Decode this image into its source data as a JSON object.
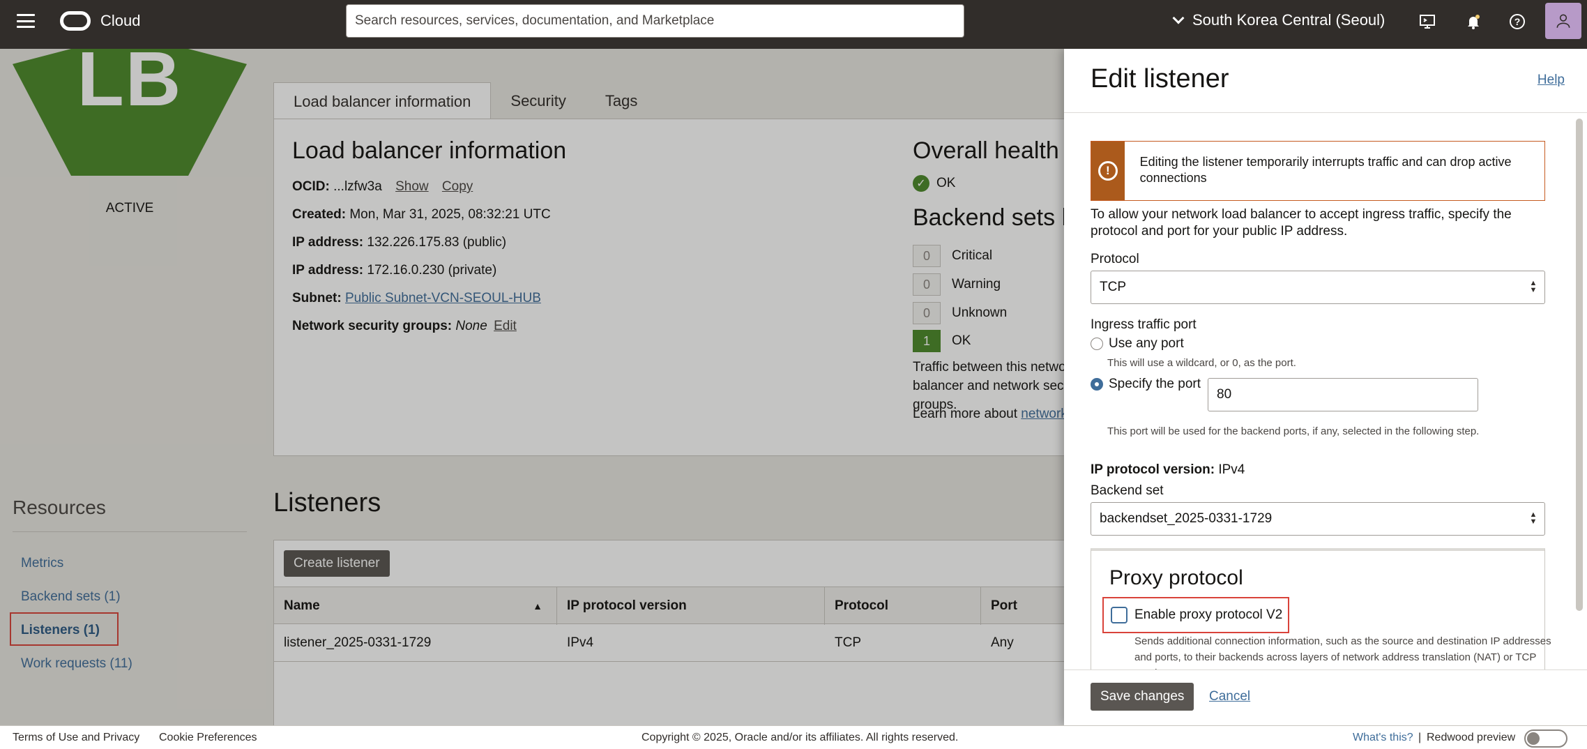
{
  "topbar": {
    "brand": "Cloud",
    "search_placeholder": "Search resources, services, documentation, and Marketplace",
    "region": "South Korea Central (Seoul)"
  },
  "lb": {
    "badge": "LB",
    "status": "ACTIVE",
    "tabs": [
      "Load balancer information",
      "Security",
      "Tags"
    ],
    "info_title": "Load balancer information",
    "ocid_label": "OCID:",
    "ocid_value": "...lzfw3a",
    "show": "Show",
    "copy": "Copy",
    "created_label": "Created:",
    "created_value": "Mon, Mar 31, 2025, 08:32:21 UTC",
    "ip_label": "IP address:",
    "ip_public": "132.226.175.83 (public)",
    "ip_private": "172.16.0.230 (private)",
    "subnet_label": "Subnet:",
    "subnet_value": "Public Subnet-VCN-SEOUL-HUB",
    "nsg_label": "Network security groups:",
    "nsg_value": "None",
    "nsg_edit": "Edit",
    "health_title": "Overall health",
    "health_value": "OK",
    "backend_health_title": "Backend sets health",
    "counts": [
      {
        "count": "0",
        "label": "Critical"
      },
      {
        "count": "0",
        "label": "Warning"
      },
      {
        "count": "0",
        "label": "Unknown"
      },
      {
        "count": "1",
        "label": "OK"
      }
    ],
    "traffic_text": "Traffic between this network load balancer and network security groups.",
    "learn_prefix": "Learn more about",
    "learn_link": "network"
  },
  "resources": {
    "title": "Resources",
    "items": [
      "Metrics",
      "Backend sets (1)",
      "Listeners (1)",
      "Work requests (11)"
    ]
  },
  "listeners": {
    "title": "Listeners",
    "create_button": "Create listener",
    "columns": [
      "Name",
      "IP protocol version",
      "Protocol",
      "Port"
    ],
    "rows": [
      {
        "name": "listener_2025-0331-1729",
        "ip_version": "IPv4",
        "protocol": "TCP",
        "port": "Any"
      }
    ]
  },
  "footer": {
    "terms": "Terms of Use and Privacy",
    "cookies": "Cookie Preferences",
    "copyright": "Copyright © 2025, Oracle and/or its affiliates. All rights reserved.",
    "whats_this": "What's this?",
    "separator": "|",
    "redwood": "Redwood preview"
  },
  "drawer": {
    "title": "Edit listener",
    "help": "Help",
    "warning": "Editing the listener temporarily interrupts traffic and can drop active connections",
    "intro": "To allow your network load balancer to accept ingress traffic, specify the protocol and port for your public IP address.",
    "protocol_label": "Protocol",
    "protocol_value": "TCP",
    "ingress_label": "Ingress traffic port",
    "any_port_label": "Use any port",
    "any_port_hint": "This will use a wildcard, or 0, as the port.",
    "specify_label": "Specify the port",
    "port_value": "80",
    "port_hint": "This port will be used for the backend ports, if any, selected in the following step.",
    "ip_version_label": "IP protocol version:",
    "ip_version_value": "IPv4",
    "backend_label": "Backend set",
    "backend_value": "backendset_2025-0331-1729",
    "proxy_title": "Proxy protocol",
    "proxy_checkbox": "Enable proxy protocol V2",
    "proxy_desc": "Sends additional connection information, such as the source and destination IP addresses and ports, to their backends across layers of network address translation (NAT) or TCP proxies.",
    "save": "Save changes",
    "cancel": "Cancel"
  },
  "colors": {
    "topbar": "#312d2a",
    "accent_green": "#4c8a2b",
    "link_blue": "#3f6d9a",
    "warning_orange": "#ab5a1c",
    "highlight_red": "#d9433a"
  }
}
